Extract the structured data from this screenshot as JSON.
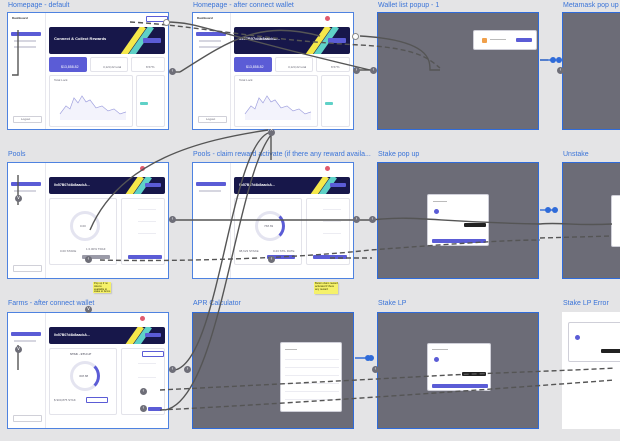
{
  "frames": {
    "homepage_default": {
      "label": "Homepage - default",
      "sidebar_header": "Dashboard",
      "banner_title": "Connect & Collect Rewards",
      "stat_a": "$13,858.82",
      "stat_b": "3,123,22 total",
      "stat_c": "8.57%",
      "chart_title": "Total Lock",
      "btn": "Logout"
    },
    "homepage_after": {
      "label": "Homepage - after connect wallet",
      "sidebar_header": "Dashboard",
      "banner_title": "0x57B07d4b8aacbA...",
      "stat_a": "$13,858.82",
      "stat_b": "3,123,22 total",
      "stat_c": "8.57%",
      "chart_title": "Total Lock",
      "btn": "Logout"
    },
    "wallet_list": {
      "label": "Wallet list popup - 1"
    },
    "metamask": {
      "label": "Metamask pop up"
    },
    "pools": {
      "label": "Pools",
      "banner_title": "0x57B07d4b8aacbA...",
      "center_val": "0.00",
      "left_val": "0.00 STAKE",
      "right_val": "1 0.00% TRAF"
    },
    "pools_reward": {
      "label": "Pools - claim reward activate (if there any reward availa...",
      "banner_title": "0x57B07d4b8aacbA...",
      "center_val": "768.69",
      "left_val": "98,623 STAKE",
      "right_val": "0.23 STIL RATE"
    },
    "stake_popup": {
      "label": "Stake pop up"
    },
    "unstake": {
      "label": "Unstake"
    },
    "farms_after": {
      "label": "Farms - after connect wallet",
      "banner_title": "0x57B07d4b8aacbA...",
      "pair": "STAK - ETH LP",
      "center_val": "308.88",
      "left_val": "$ 900,875 STAK"
    },
    "apr_calc": {
      "label": "APR Calculator"
    },
    "stake_lp": {
      "label": "Stake LP"
    },
    "stake_lp_error": {
      "label": "Stake LP Error"
    }
  },
  "notes": {
    "note_left": "Pop up if no tokens available to stake to farms",
    "note_mid": "Button claim reward activated if there any reward"
  },
  "colors": {
    "canvas": "#e4e4e6",
    "frame_border": "#2f6bd9",
    "accent": "#5b5cd6",
    "dark_frame": "#6c6c77",
    "sticky": "#f5f16a"
  }
}
